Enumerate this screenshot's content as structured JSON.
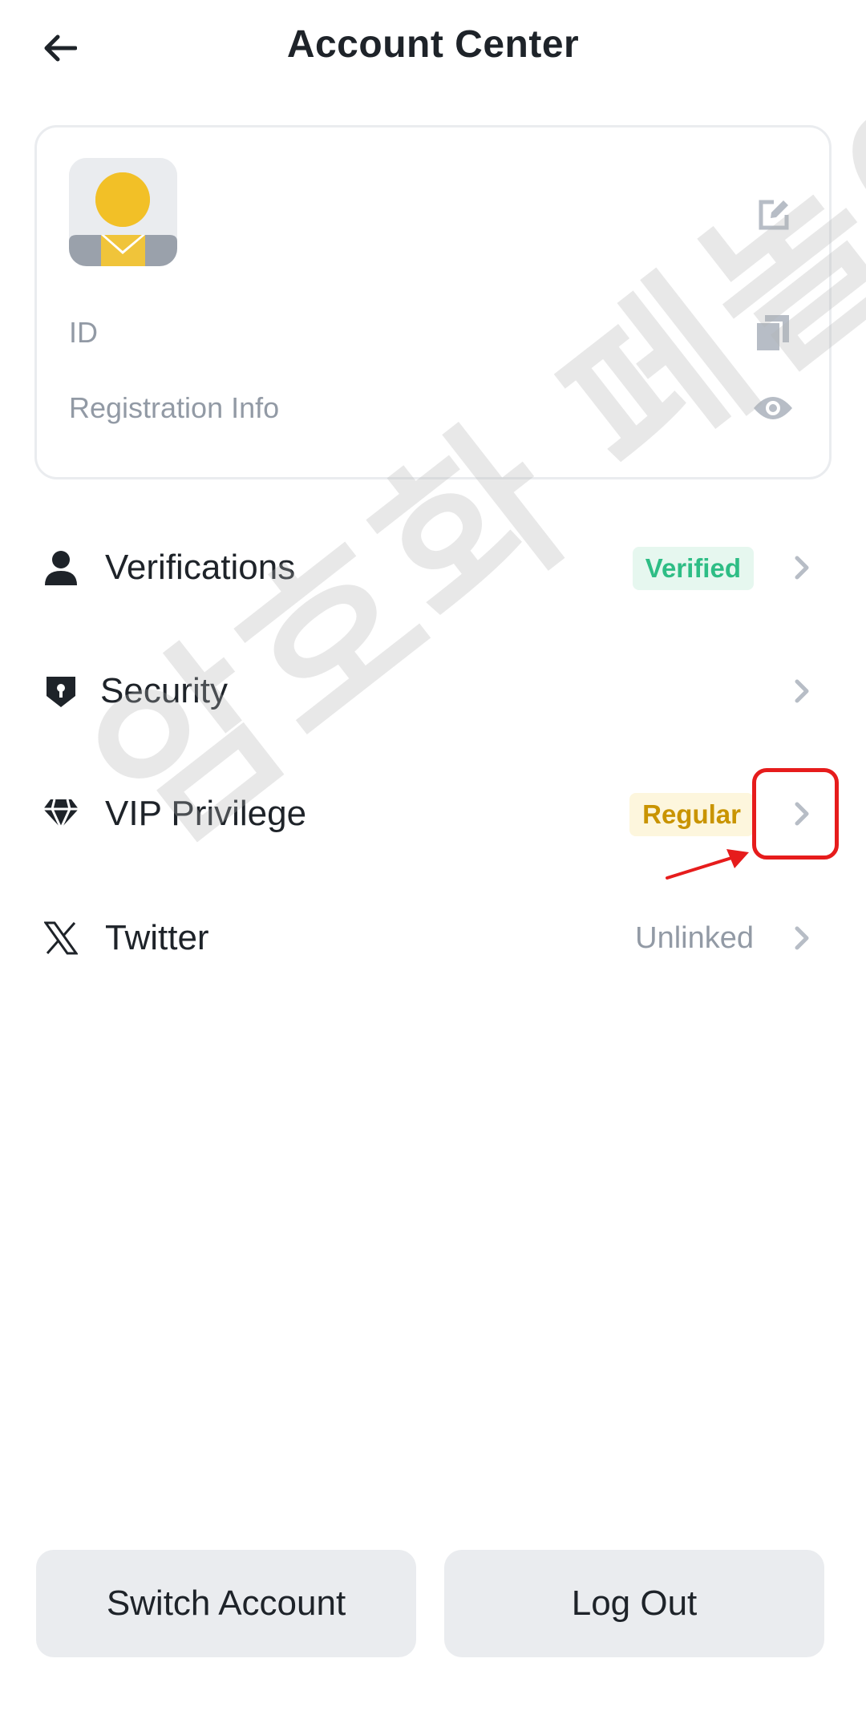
{
  "header": {
    "title": "Account Center",
    "back_icon": "arrow-left-icon"
  },
  "profile": {
    "avatar_icon": "user-avatar",
    "edit_icon": "edit-icon",
    "id_label": "ID",
    "copy_icon": "copy-icon",
    "registration_label": "Registration Info",
    "eye_icon": "eye-icon"
  },
  "menu": [
    {
      "label": "Verifications",
      "icon": "person-icon",
      "status": "Verified",
      "status_style": "badge-green"
    },
    {
      "label": "Security",
      "icon": "shield-icon",
      "status": ""
    },
    {
      "label": "VIP Privilege",
      "icon": "diamond-icon",
      "status": "Regular",
      "status_style": "badge-gold"
    },
    {
      "label": "Twitter",
      "icon": "x-logo-icon",
      "status": "Unlinked",
      "status_style": "text-gray"
    }
  ],
  "watermark": "암호화 페놀이터",
  "buttons": {
    "switch_account": "Switch Account",
    "log_out": "Log Out"
  },
  "colors": {
    "verified": "#2ebd85",
    "regular": "#c99400",
    "annotation_red": "#e61c1c",
    "muted": "#929aa5"
  }
}
